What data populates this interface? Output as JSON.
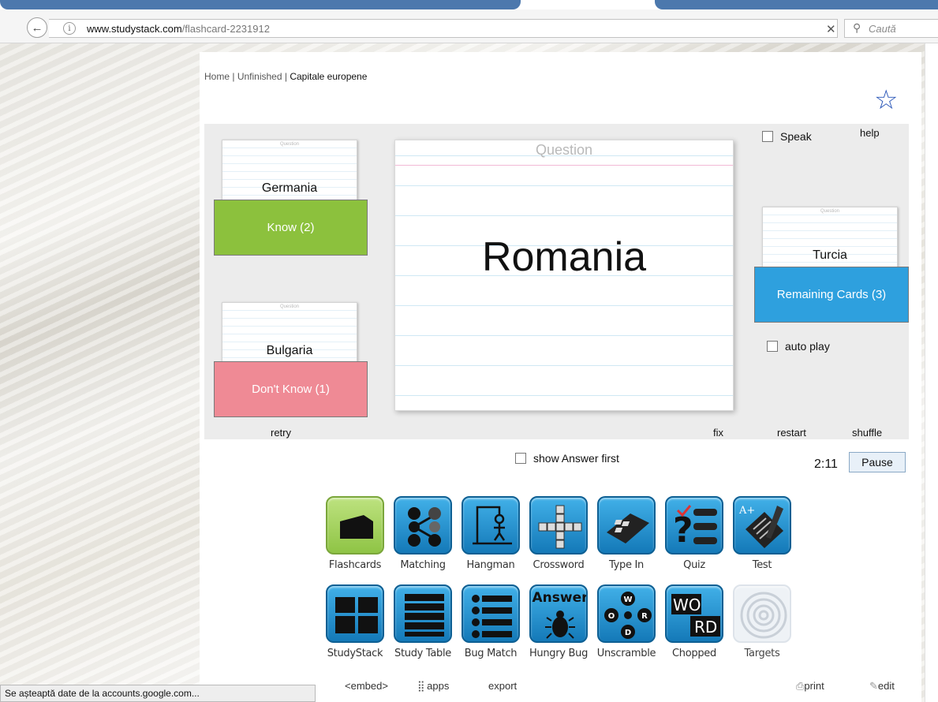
{
  "browser": {
    "url_domain": "www.studystack.com",
    "url_path": "/flashcard-2231912",
    "search_placeholder": "Caută",
    "back_glyph": "←",
    "clear_glyph": "✕",
    "info_glyph": "i",
    "search_glyph": "⚲"
  },
  "breadcrumb": {
    "home": "Home",
    "sep1": " | ",
    "unfinished": "Unfinished",
    "sep2": " | ",
    "current": "Capitale europene"
  },
  "favorite_glyph": "☆",
  "top_controls": {
    "speak": "Speak",
    "help": "help"
  },
  "know_pile": {
    "card_header": "Question",
    "word": "Germania",
    "label": "Know (2)"
  },
  "dont_know_pile": {
    "card_header": "Question",
    "word": "Bulgaria",
    "label": "Don't Know (1)"
  },
  "remaining_pile": {
    "card_header": "Question",
    "word": "Turcia",
    "label": "Remaining Cards (3)"
  },
  "main_card": {
    "header": "Question",
    "word": "Romania"
  },
  "auto_play": "auto play",
  "bottom_links": {
    "retry": "retry",
    "fix": "fix",
    "restart": "restart",
    "shuffle": "shuffle"
  },
  "show_answer_first": "show Answer first",
  "timer": "2:11",
  "pause_label": "Pause",
  "apps_row1": [
    "Flashcards",
    "Matching",
    "Hangman",
    "Crossword",
    "Type In",
    "Quiz",
    "Test"
  ],
  "apps_row2": [
    "StudyStack",
    "Study Table",
    "Bug Match",
    "Hungry Bug",
    "Unscramble",
    "Chopped",
    "Targets"
  ],
  "icon_text": {
    "answer": "Answer",
    "wo": "WO",
    "rd": "RD",
    "aplus": "A+",
    "w": "W",
    "o": "O",
    "r": "R",
    "d": "D"
  },
  "footer": {
    "embed": "<embed>",
    "apps": "apps",
    "export": "export",
    "print": "print",
    "edit": "edit"
  },
  "status_text": "Se așteaptă date de la accounts.google.com...",
  "colors": {
    "know": "#8cc13d",
    "dont_know": "#ef8a95",
    "remaining": "#2ea0de",
    "app_icon": "#1a8fd0"
  }
}
